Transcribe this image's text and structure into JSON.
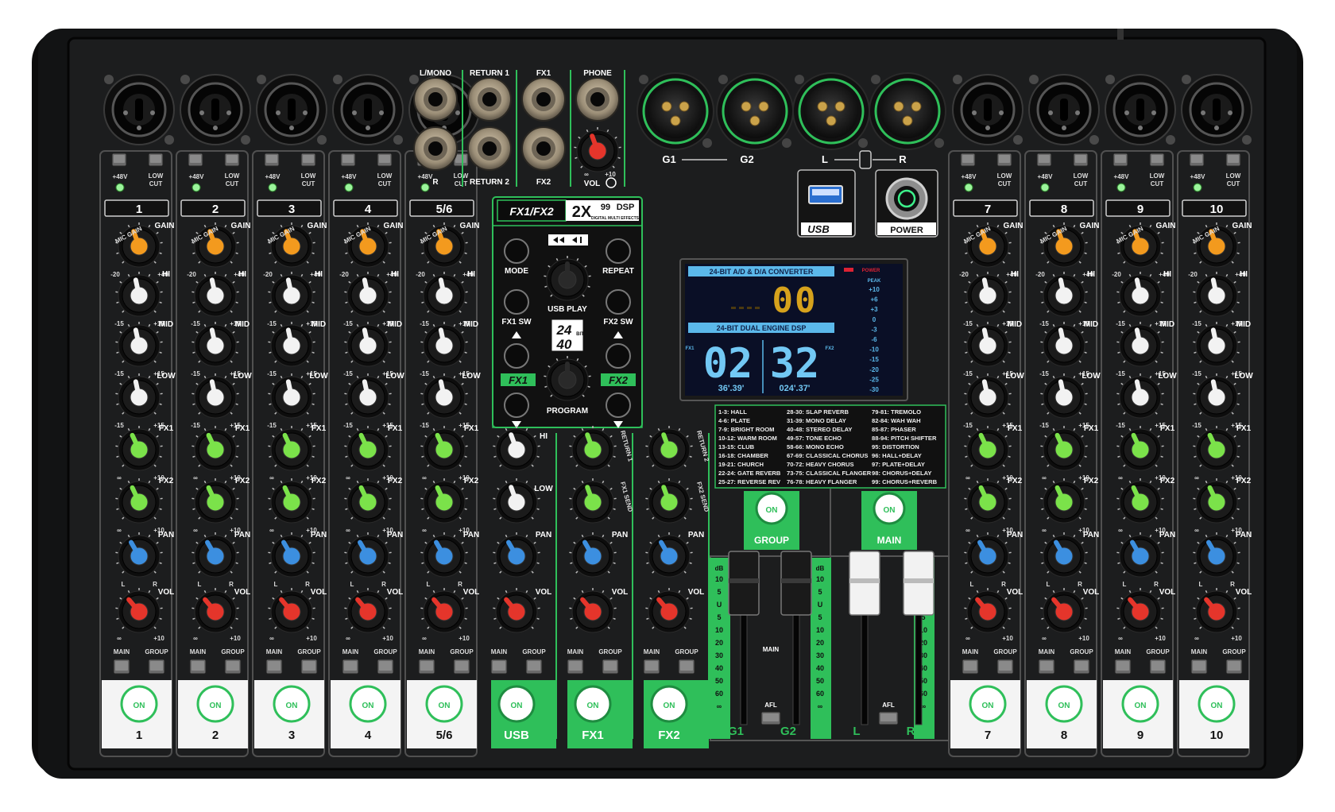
{
  "channels_mono": [
    "1",
    "2",
    "3",
    "4"
  ],
  "channels_stereo": [
    "5/6"
  ],
  "channels_right": [
    "7",
    "8",
    "9",
    "10"
  ],
  "center_strips": [
    "USB",
    "FX1",
    "FX2"
  ],
  "knob_labels": {
    "gain": "GAIN",
    "mic_gain": "MIC GAIN",
    "hi": "HI",
    "mid": "MID",
    "low": "LOW",
    "fx1": "FX1",
    "fx2": "FX2",
    "pan": "PAN",
    "vol": "VOL"
  },
  "knob_scales": {
    "gain_min": "-20",
    "gain_mid": "+60",
    "gain_max": "+40",
    "eq_min": "-15",
    "eq_max": "+15",
    "send_max": "+10",
    "pan_l": "L",
    "pan_r": "R",
    "unity": "U",
    "inf": "∞"
  },
  "switch_labels": {
    "phantom": "+48V",
    "low_cut_1": "LOW",
    "low_cut_2": "CUT",
    "main": "MAIN",
    "group": "GROUP",
    "on": "ON"
  },
  "rear_jacks": {
    "lmono": "L/MONO",
    "r": "R",
    "return1": "RETURN 1",
    "return2": "RETURN 2",
    "fx1": "FX1",
    "fx2": "FX2",
    "phone": "PHONE",
    "vol": "VOL",
    "inf": "∞",
    "plus10": "+10"
  },
  "xlr_outputs": {
    "g1": "G1",
    "g2": "G2",
    "l": "L",
    "r": "R"
  },
  "usb_label": "USB",
  "power_label": "POWER",
  "dsp": {
    "badge_fx": "FX1/FX2",
    "badge_big": "2X",
    "badge_num": "99",
    "badge_dsp": "DSP",
    "badge_sub": "DIGITAL MULTI EFFECTS",
    "mode": "MODE",
    "repeat": "REPEAT",
    "usb_play": "USB PLAY",
    "fx1_sw": "FX1 SW",
    "fx2_sw": "FX2 SW",
    "bit_a": "24",
    "bit_b": "40",
    "bit_side": "BIT",
    "fx1": "FX1",
    "fx2": "FX2",
    "program": "PROGRAM"
  },
  "lcd": {
    "top_banner": "24-BIT  A/D & D/A  CONVERTER",
    "power": "POWER",
    "peak": "PEAK",
    "meter": [
      "+10",
      "+6",
      "+3",
      "0",
      "-3",
      "-6",
      "-10",
      "-15",
      "-20",
      "-25",
      "-30"
    ],
    "value_top": "00",
    "mid_banner": "24-BIT  DUAL  ENGINE  DSP",
    "fx1_prog": "02",
    "fx2_prog": "32",
    "fx1_param": "36'.39'",
    "fx2_param": "024'.37'"
  },
  "presets": [
    [
      "1-3: HALL",
      "28-30: SLAP REVERB",
      "79-81: TREMOLO"
    ],
    [
      "4-6: PLATE",
      "31-39: MONO DELAY",
      "82-84: WAH WAH"
    ],
    [
      "7-9: BRIGHT ROOM",
      "40-48: STEREO DELAY",
      "85-87: PHASER"
    ],
    [
      "10-12: WARM ROOM",
      "49-57: TONE ECHO",
      "88-94: PITCH SHIFTER"
    ],
    [
      "13-15: CLUB",
      "58-66: MONO ECHO",
      "95: DISTORTION"
    ],
    [
      "16-18: CHAMBER",
      "67-69: CLASSICAL CHORUS",
      "96: HALL+DELAY"
    ],
    [
      "19-21: CHURCH",
      "70-72: HEAVY CHORUS",
      "97: PLATE+DELAY"
    ],
    [
      "22-24: GATE REVERB",
      "73-75: CLASSICAL FLANGER",
      "98: CHORUS+DELAY"
    ],
    [
      "25-27: REVERSE REV",
      "76-78: HEAVY FLANGER",
      "99: CHORUS+REVERB"
    ]
  ],
  "usb_strip": {
    "hi": "HI",
    "low": "LOW",
    "pan": "PAN",
    "vol": "VOL"
  },
  "fx1_strip": {
    "return": "RETURN 1",
    "send": "FX1 SEND",
    "pan": "PAN",
    "vol": "VOL"
  },
  "fx2_strip": {
    "return": "RETURN 2",
    "send": "FX2 SEND",
    "pan": "PAN",
    "vol": "VOL"
  },
  "master": {
    "group": "GROUP",
    "main": "MAIN",
    "afl": "AFL",
    "db": "dB",
    "scale": [
      "10",
      "5",
      "U",
      "5",
      "10",
      "20",
      "30",
      "40",
      "50",
      "60",
      "∞"
    ],
    "fader_labels": [
      "G1",
      "G2",
      "L",
      "R"
    ]
  },
  "colors": {
    "chassis": "#1c1d1e",
    "green_accent": "#2fbf5a",
    "gain_knob": "#f39a1e",
    "eq_knob": "#f2f2f2",
    "fx_knob": "#7be24a",
    "pan_knob": "#3c8fe0",
    "vol_knob": "#e5352b",
    "lcd_bg": "#0a0f26",
    "lcd_banner": "#5bb8ea",
    "lcd_amber": "#d6a21c"
  }
}
